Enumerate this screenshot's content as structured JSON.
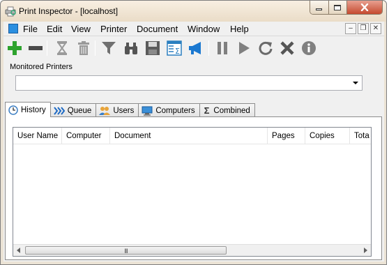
{
  "window": {
    "title": "Print Inspector - [localhost]"
  },
  "menubar": {
    "items": [
      "File",
      "Edit",
      "View",
      "Printer",
      "Document",
      "Window",
      "Help"
    ]
  },
  "toolbar": {
    "buttons": [
      "add-printer",
      "remove-printer",
      "hourglass",
      "trash",
      "filter",
      "binoculars",
      "save",
      "sum-table",
      "megaphone",
      "pause",
      "play",
      "refresh",
      "cancel",
      "info"
    ]
  },
  "monitored": {
    "label": "Monitored Printers",
    "value": ""
  },
  "tabs": [
    {
      "label": "History",
      "active": true
    },
    {
      "label": "Queue"
    },
    {
      "label": "Users"
    },
    {
      "label": "Computers"
    },
    {
      "label": "Combined"
    }
  ],
  "table": {
    "columns": [
      "User Name",
      "Computer",
      "Document",
      "Pages",
      "Copies",
      "Tota"
    ],
    "rows": []
  },
  "scrollbar": {
    "grip": "III"
  },
  "colors": {
    "accent_green": "#2ea32e",
    "title_bg": "#eadcc7",
    "close_red": "#c54a2f"
  }
}
